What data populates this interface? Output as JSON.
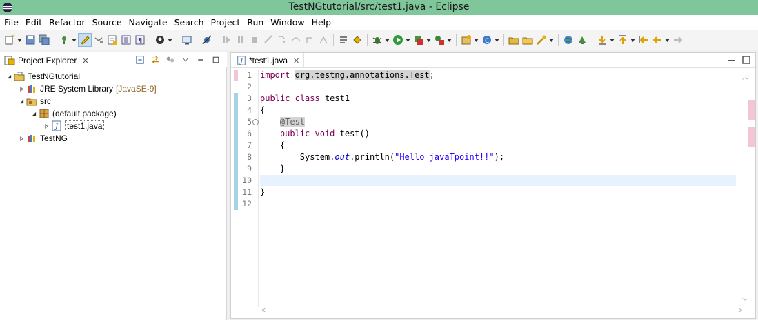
{
  "window": {
    "title": "TestNGtutorial/src/test1.java - Eclipse"
  },
  "menubar": {
    "items": [
      "File",
      "Edit",
      "Refactor",
      "Source",
      "Navigate",
      "Search",
      "Project",
      "Run",
      "Window",
      "Help"
    ]
  },
  "toolbar": {
    "icons": [
      "new-icon",
      "save-icon",
      "save-all-icon",
      "terminal-icon",
      "pin-icon",
      "highlight-icon",
      "toggle-mark-icon",
      "show-whitespace-icon",
      "paragraph-icon",
      "profile-icon",
      "console-icon",
      "skip-breakpoints-icon",
      "resume-icon",
      "suspend-icon",
      "terminate-icon",
      "disconnect-icon",
      "step-into-icon",
      "step-over-icon",
      "step-return-icon",
      "use-step-filters-icon",
      "debug-icon",
      "run-icon",
      "coverage-icon",
      "external-tools-icon",
      "new-class-icon",
      "new-java-project-icon",
      "open-type-icon",
      "search-icon",
      "globe-icon",
      "mark-occurrences-icon",
      "next-annotation-icon",
      "prev-annotation-icon",
      "last-edit-icon",
      "back-icon",
      "forward-icon"
    ]
  },
  "explorer": {
    "tab_label": "Project Explorer",
    "tree": [
      {
        "label": "TestNGtutorial",
        "decoration": "",
        "icon": "project-icon",
        "level": 0,
        "expanded": true
      },
      {
        "label": "JRE System Library",
        "decoration": "[JavaSE-9]",
        "icon": "library-icon",
        "level": 1,
        "expanded": false
      },
      {
        "label": "src",
        "decoration": "",
        "icon": "source-folder-icon",
        "level": 1,
        "expanded": true
      },
      {
        "label": "(default package)",
        "decoration": "",
        "icon": "package-icon",
        "level": 2,
        "expanded": true
      },
      {
        "label": "test1.java",
        "decoration": "",
        "icon": "java-file-icon",
        "level": 3,
        "expanded": false
      },
      {
        "label": "TestNG",
        "decoration": "",
        "icon": "library-icon",
        "level": 1,
        "expanded": false
      }
    ]
  },
  "editor": {
    "tab_label": "*test1.java",
    "line_numbers": [
      "1",
      "2",
      "3",
      "4",
      "5",
      "6",
      "7",
      "8",
      "9",
      "10",
      "11",
      "12"
    ],
    "code": {
      "l1_kw": "import",
      "l1_pkg": "org.testng.annotations.Test",
      "l1_semi": ";",
      "l3_kw1": "public",
      "l3_kw2": "class",
      "l3_name": " test1",
      "l4": "{",
      "l5_ann": "@Test",
      "l6_kw1": "public",
      "l6_kw2": "void",
      "l6_rest": " test()",
      "l7": "{",
      "l8_a": "System.",
      "l8_field": "out",
      "l8_b": ".println(",
      "l8_str": "\"Hello javaTpoint!!\"",
      "l8_c": ");",
      "l9": "}",
      "l11": "}"
    }
  }
}
